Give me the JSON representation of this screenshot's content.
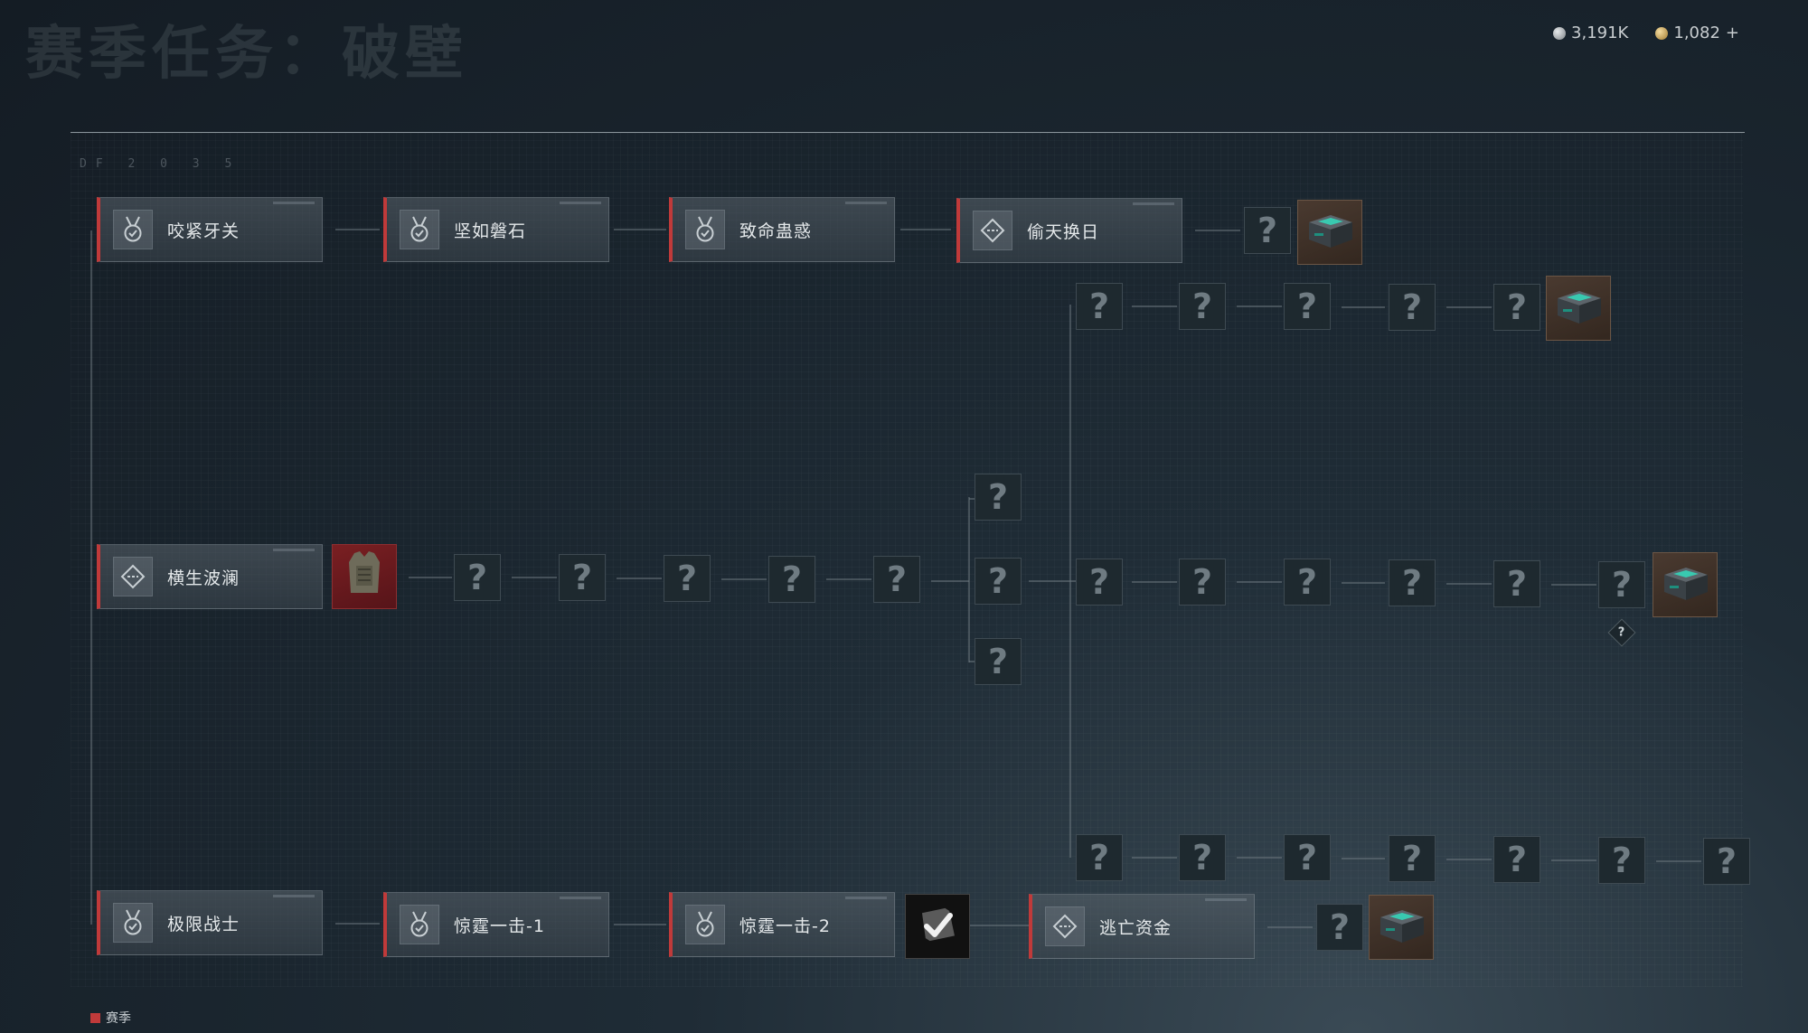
{
  "page": {
    "title": "赛季任务：破壁"
  },
  "deco": {
    "id_text": "DF 2 0 3 5"
  },
  "currency": {
    "silver": "3,191K",
    "gold": "1,082",
    "add_label": "+"
  },
  "tasks": [
    {
      "label": "咬紧牙关",
      "icon": "medal-check-icon"
    },
    {
      "label": "坚如磐石",
      "icon": "medal-check-icon"
    },
    {
      "label": "致命蛊惑",
      "icon": "medal-check-icon"
    },
    {
      "label": "偷天换日",
      "icon": "diamond-dots-icon"
    },
    {
      "label": "横生波澜",
      "icon": "diamond-dots-icon"
    },
    {
      "label": "极限战士",
      "icon": "medal-check-icon"
    },
    {
      "label": "惊霆一击-1",
      "icon": "medal-check-icon"
    },
    {
      "label": "惊霆一击-2",
      "icon": "medal-check-icon"
    },
    {
      "label": "逃亡资金",
      "icon": "diamond-dots-icon"
    }
  ],
  "unknown_symbol": "?",
  "hint_symbol": "?",
  "completed_icon": "checkmark-icon",
  "reward_icons": {
    "crate": "supply-crate-icon",
    "armor": "armor-vest-icon"
  },
  "legend": {
    "label": "赛季",
    "color": "#c03a3a"
  }
}
